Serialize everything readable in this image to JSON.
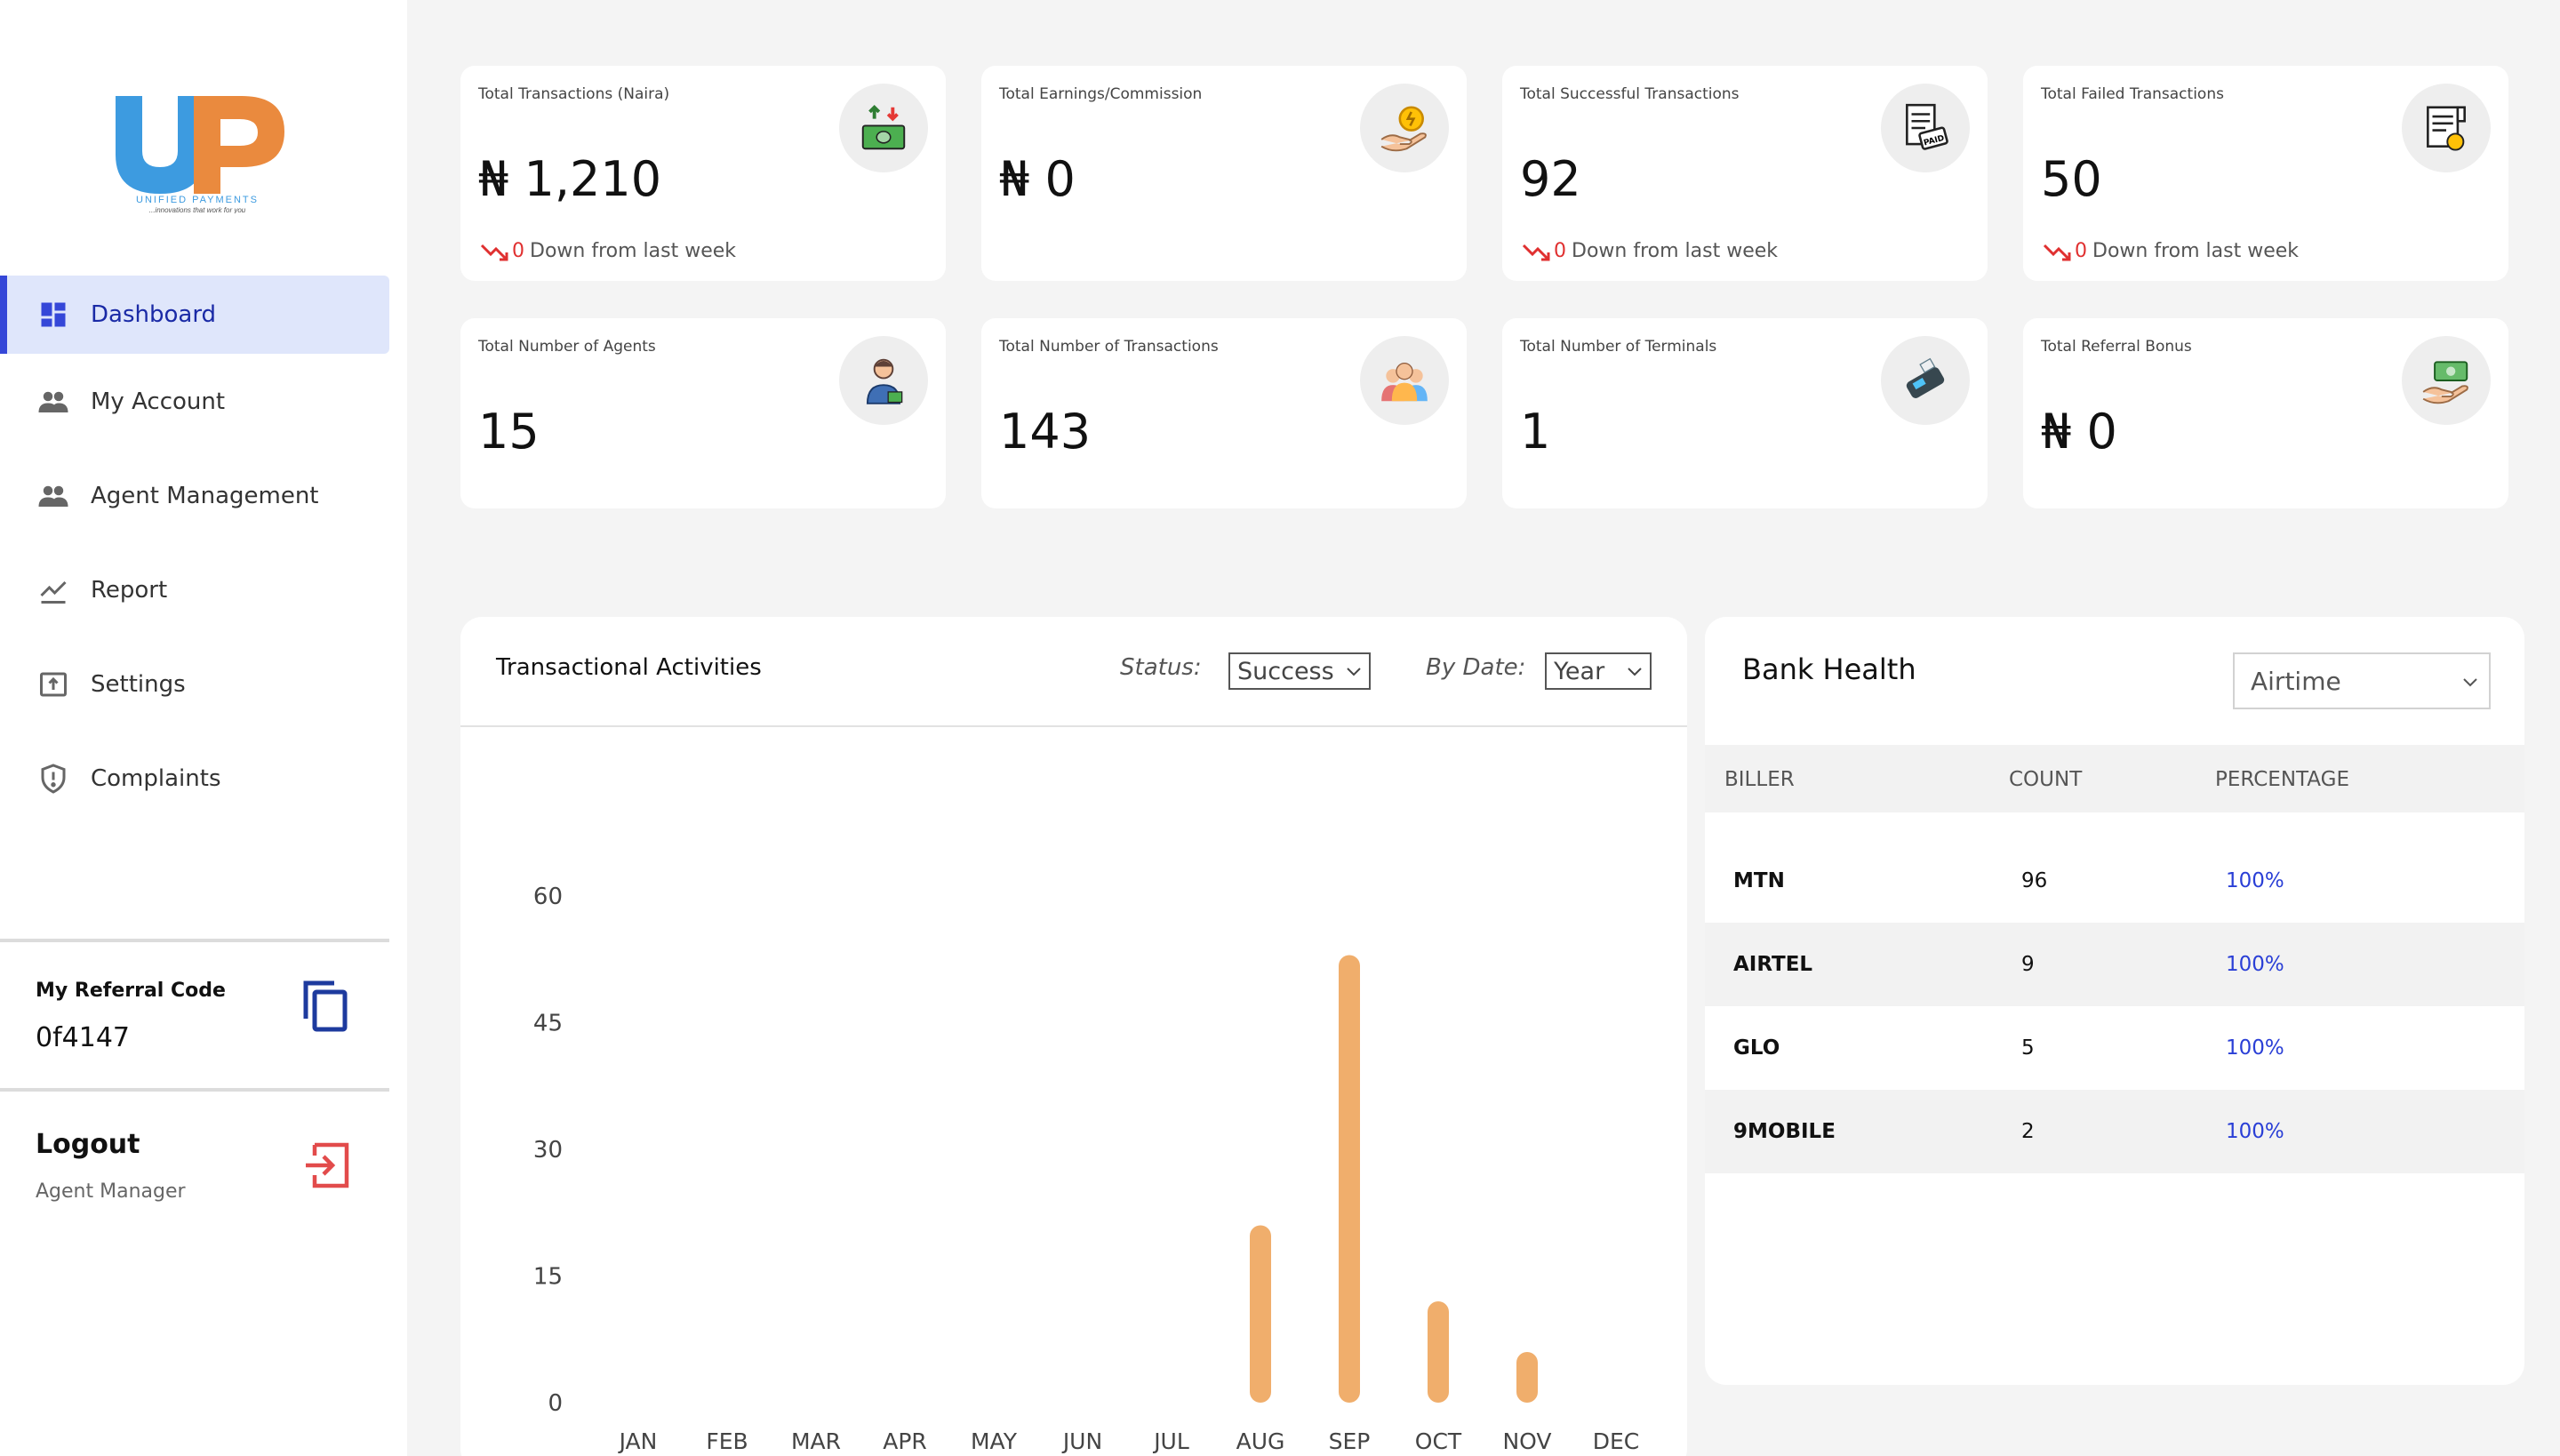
{
  "sidebar": {
    "logo": {
      "letters": "UP",
      "brand": "UNIFIED PAYMENTS",
      "tagline": "...innovations that work for you"
    },
    "nav": [
      {
        "label": "Dashboard",
        "icon": "dashboard-grid-icon",
        "active": true
      },
      {
        "label": "My Account",
        "icon": "people-icon"
      },
      {
        "label": "Agent Management",
        "icon": "people-icon"
      },
      {
        "label": "Report",
        "icon": "line-chart-icon"
      },
      {
        "label": "Settings",
        "icon": "settings-folder-icon"
      },
      {
        "label": "Complaints",
        "icon": "shield-alert-icon"
      }
    ],
    "referral": {
      "label": "My Referral Code",
      "code": "0f4147"
    },
    "logout": {
      "label": "Logout",
      "role": "Agent Manager"
    }
  },
  "stats": [
    {
      "title": "Total Transactions (Naira)",
      "value": "₦ 1,210",
      "icon": "cash-exchange-icon",
      "trend_value": "0",
      "trend_text": "Down from last week"
    },
    {
      "title": "Total Earnings/Commission",
      "value": "₦ 0",
      "icon": "hand-coin-icon"
    },
    {
      "title": "Total Successful Transactions",
      "value": "92",
      "icon": "paid-receipt-icon",
      "trend_value": "0",
      "trend_text": "Down from last week"
    },
    {
      "title": "Total Failed Transactions",
      "value": "50",
      "icon": "failed-receipt-icon",
      "trend_value": "0",
      "trend_text": "Down from last week"
    },
    {
      "title": "Total Number of Agents",
      "value": "15",
      "icon": "agent-person-icon"
    },
    {
      "title": "Total Number of Transactions",
      "value": "143",
      "icon": "group-people-icon"
    },
    {
      "title": "Total Number of Terminals",
      "value": "1",
      "icon": "pos-terminal-icon"
    },
    {
      "title": "Total Referral Bonus",
      "value": "₦ 0",
      "icon": "hand-cash-icon"
    }
  ],
  "transactions": {
    "title": "Transactional Activities",
    "status_label": "Status:",
    "status_value": "Success",
    "date_label": "By Date:",
    "date_value": "Year"
  },
  "chart_data": {
    "type": "bar",
    "categories": [
      "JAN",
      "FEB",
      "MAR",
      "APR",
      "MAY",
      "JUN",
      "JUL",
      "AUG",
      "SEP",
      "OCT",
      "NOV",
      "DEC"
    ],
    "values": [
      0,
      0,
      0,
      0,
      0,
      0,
      0,
      21,
      53,
      12,
      6,
      0
    ],
    "yticks": [
      0,
      15,
      30,
      45,
      60
    ],
    "ylim": [
      0,
      60
    ],
    "grid": false,
    "bar_color": "#f0ae6c"
  },
  "bank_health": {
    "title": "Bank Health",
    "filter": "Airtime",
    "columns": [
      "BILLER",
      "COUNT",
      "PERCENTAGE"
    ],
    "rows": [
      {
        "biller": "MTN",
        "count": "96",
        "percentage": "100%"
      },
      {
        "biller": "AIRTEL",
        "count": "9",
        "percentage": "100%"
      },
      {
        "biller": "GLO",
        "count": "5",
        "percentage": "100%"
      },
      {
        "biller": "9MOBILE",
        "count": "2",
        "percentage": "100%"
      }
    ]
  },
  "colors": {
    "accent": "#3547d8",
    "active_bg": "#dfe6fb",
    "down": "#e03030",
    "link": "#2a3fd6"
  }
}
